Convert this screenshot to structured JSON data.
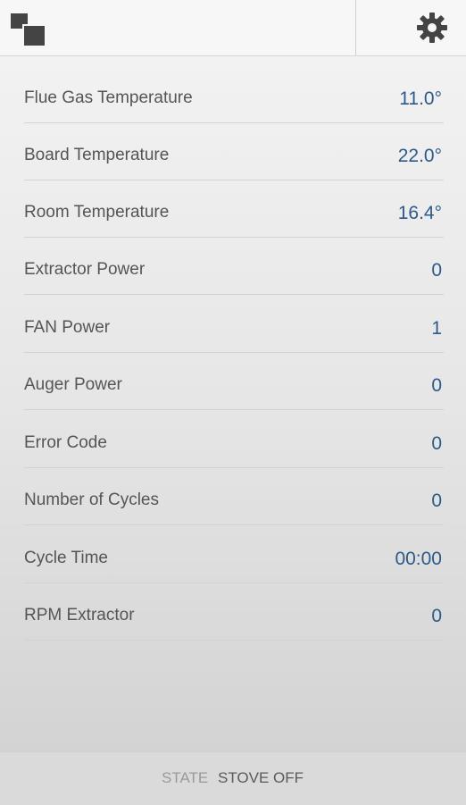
{
  "header": {
    "menu_icon": "windows-icon",
    "settings_icon": "gear-icon"
  },
  "readings": [
    {
      "label": "Flue Gas Temperature",
      "value": "11.0°"
    },
    {
      "label": "Board Temperature",
      "value": "22.0°"
    },
    {
      "label": "Room Temperature",
      "value": "16.4°"
    },
    {
      "label": "Extractor Power",
      "value": "0"
    },
    {
      "label": "FAN Power",
      "value": "1"
    },
    {
      "label": "Auger Power",
      "value": "0"
    },
    {
      "label": "Error Code",
      "value": "0"
    },
    {
      "label": "Number of Cycles",
      "value": "0"
    },
    {
      "label": "Cycle Time",
      "value": "00:00"
    },
    {
      "label": "RPM Extractor",
      "value": "0"
    }
  ],
  "footer": {
    "state_label": "STATE",
    "state_value": "STOVE OFF"
  },
  "colors": {
    "value_text": "#2c5a8a",
    "label_text": "#555555"
  }
}
